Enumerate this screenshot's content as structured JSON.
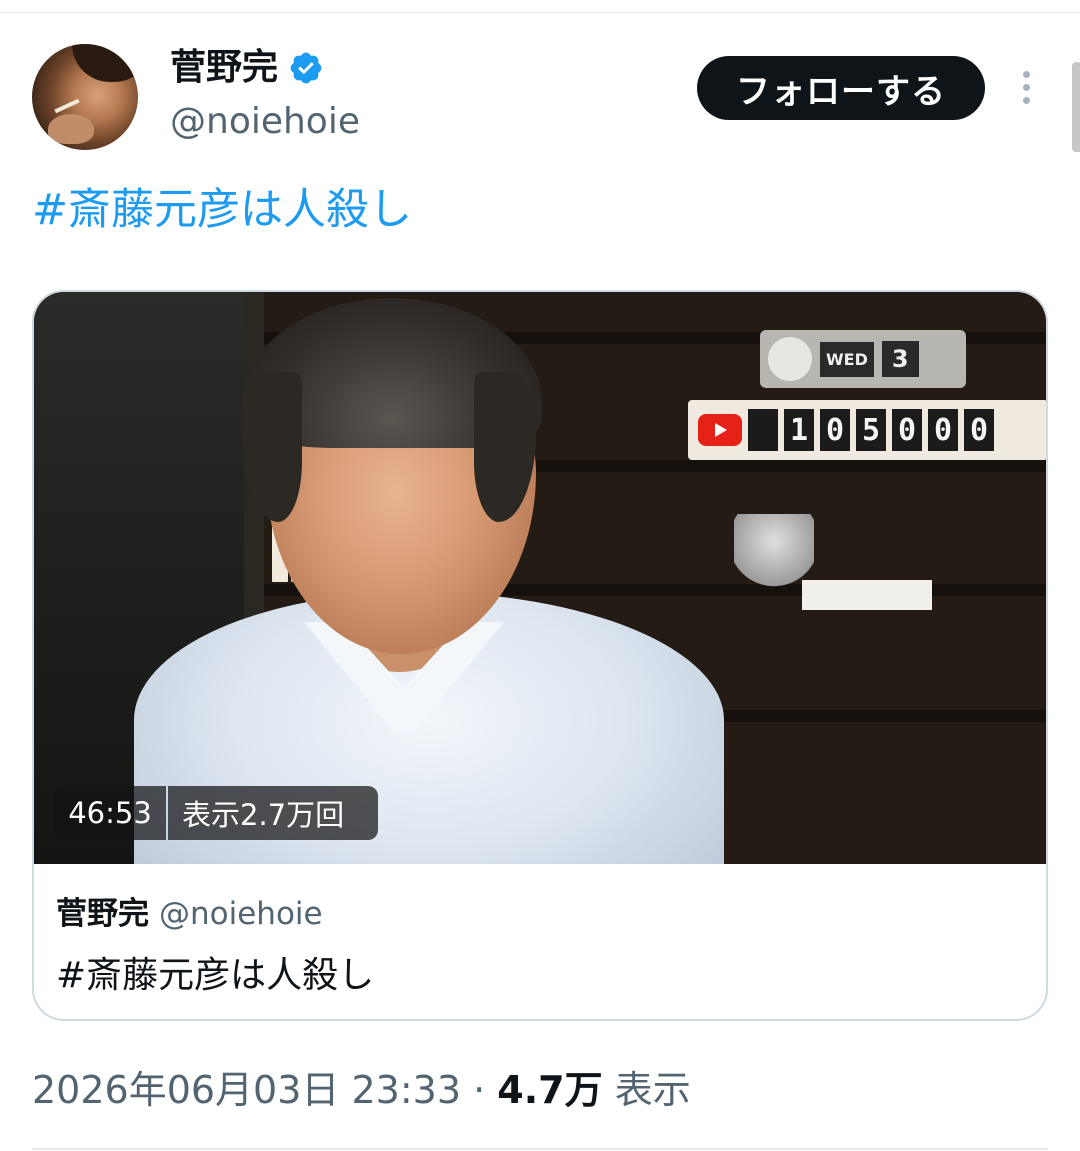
{
  "author": {
    "display_name": "菅野完",
    "handle": "@noiehoie",
    "verified": true,
    "avatar": "avatar"
  },
  "actions": {
    "follow_label": "フォローする",
    "more_icon": "more-vertical-icon"
  },
  "tweet": {
    "hashtag": "#斎藤元彦は人殺し"
  },
  "video": {
    "duration": "46:53",
    "views": "表示2.7万回",
    "clock_day_label": "WED",
    "clock_day_number": "3",
    "counter_digits": [
      "1",
      "0",
      "5",
      "0",
      "0",
      "0"
    ]
  },
  "quoted": {
    "display_name": "菅野完",
    "handle": "@noiehoie",
    "text": "#斎藤元彦は人殺し"
  },
  "meta": {
    "timestamp": "2026年06月03日 23:33",
    "separator": "·",
    "views_count": "4.7万",
    "views_label": "表示"
  },
  "colors": {
    "link": "#1d9bf0",
    "text_primary": "#0f1419",
    "text_secondary": "#536471",
    "button_bg": "#0f1419",
    "verified": "#1d9bf0"
  }
}
